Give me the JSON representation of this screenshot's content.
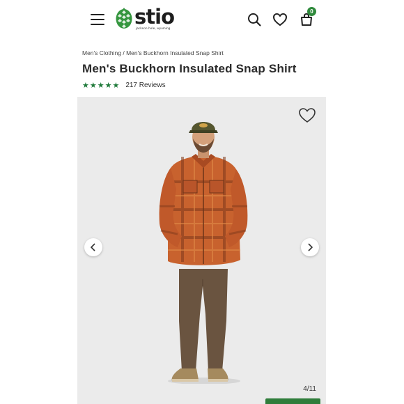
{
  "header": {
    "menu_icon": "hamburger-menu-icon",
    "logo_text": "stio",
    "logo_tagline": "jackson hole, wyoming",
    "search_icon": "search-icon",
    "wishlist_icon": "heart-icon",
    "cart_icon": "shopping-bag-icon",
    "cart_count": "0",
    "brand_color": "#2f8a3c"
  },
  "breadcrumb": {
    "items": [
      "Men's Clothing",
      "Men's Buckhorn Insulated Snap Shirt"
    ],
    "separator": "/"
  },
  "product": {
    "title": "Men's Buckhorn Insulated Snap Shirt",
    "stars": "★★★★★",
    "rating_value": 5,
    "reviews": "217 Reviews",
    "star_color": "#1f7a3a"
  },
  "gallery": {
    "counter": "4/11",
    "wishlist_icon": "heart-outline-icon",
    "prev_icon": "chevron-left-icon",
    "next_icon": "chevron-right-icon",
    "background": "#ebebeb"
  }
}
